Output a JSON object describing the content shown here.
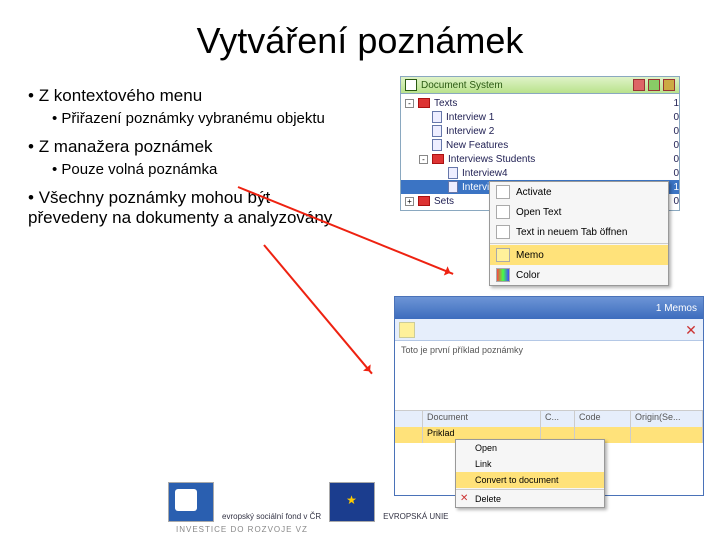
{
  "title": "Vytváření poznámek",
  "bullets": {
    "b1": "Z kontextového menu",
    "b1a": "Přiřazení poznámky vybranému objektu",
    "b2": "Z manažera poznámek",
    "b2a": "Pouze volná poznámka",
    "b3": "Všechny poznámky mohou být převedeny na dokumenty a analyzovány"
  },
  "docsys": {
    "header": "Document System",
    "rows": [
      {
        "label": "Texts",
        "num": "1",
        "level": 0,
        "icon": "folder",
        "exp": "-"
      },
      {
        "label": "Interview 1",
        "num": "0",
        "level": 1,
        "icon": "doc"
      },
      {
        "label": "Interview 2",
        "num": "0",
        "level": 1,
        "icon": "doc"
      },
      {
        "label": "New Features",
        "num": "0",
        "level": 1,
        "icon": "doc"
      },
      {
        "label": "Interviews Students",
        "num": "0",
        "level": 1,
        "icon": "folder",
        "exp": "-"
      },
      {
        "label": "Interview4",
        "num": "0",
        "level": 2,
        "icon": "doc"
      },
      {
        "label": "Interview3",
        "num": "1",
        "level": 2,
        "icon": "doc",
        "sel": true
      },
      {
        "label": "Sets",
        "num": "0",
        "level": 0,
        "icon": "folder",
        "exp": "+"
      }
    ]
  },
  "ctx": {
    "items": [
      {
        "label": "Activate",
        "icon": "activate"
      },
      {
        "label": "Open Text",
        "icon": "open"
      },
      {
        "label": "Text in neuem Tab öffnen",
        "icon": "open-tab"
      },
      {
        "label": "",
        "sep": true
      },
      {
        "label": "Memo",
        "icon": "memo"
      },
      {
        "label": "Color",
        "icon": "color"
      }
    ]
  },
  "memomgr": {
    "count_label": "1 Memos",
    "body_text": "Toto je první příklad poznámky",
    "grid_headers": [
      "",
      "Document",
      "C...",
      "Code",
      "Origin(Se..."
    ],
    "grid_row": [
      "",
      "Priklad",
      "",
      "",
      ""
    ],
    "ctx_items": [
      {
        "label": "Open"
      },
      {
        "label": "Link"
      },
      {
        "label": "Convert to document",
        "sel": true
      },
      {
        "label": "Delete",
        "icon": "x"
      }
    ]
  },
  "footer": {
    "esf_text": "evropský sociální fond v ČR",
    "eu_text": "EVROPSKÁ UNIE",
    "invest": "INVESTICE DO ROZVOJE VZ"
  }
}
